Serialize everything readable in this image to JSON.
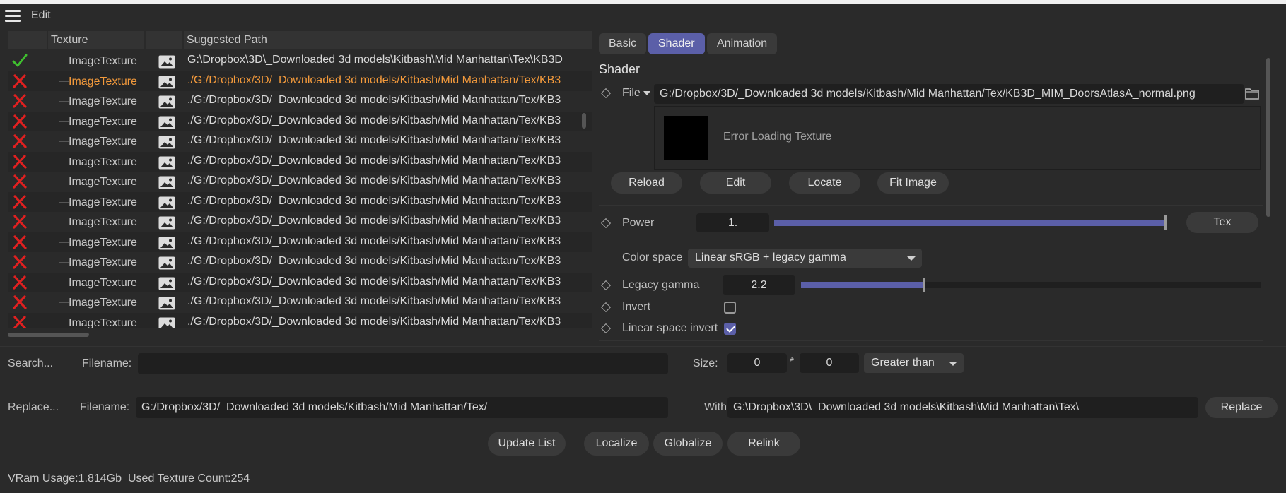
{
  "menu": {
    "edit_label": "Edit"
  },
  "table": {
    "headers": {
      "texture": "Texture",
      "suggested_path": "Suggested Path"
    },
    "rows": [
      {
        "status": "ok",
        "name": "ImageTexture",
        "path": "G:\\Dropbox\\3D\\_Downloaded 3d models\\Kitbash\\Mid Manhattan\\Tex\\KB3D",
        "selected": false
      },
      {
        "status": "error",
        "name": "ImageTexture",
        "path": "./G:/Dropbox/3D/_Downloaded 3d models/Kitbash/Mid Manhattan/Tex/KB3",
        "selected": true
      },
      {
        "status": "error",
        "name": "ImageTexture",
        "path": "./G:/Dropbox/3D/_Downloaded 3d models/Kitbash/Mid Manhattan/Tex/KB3",
        "selected": false
      },
      {
        "status": "error",
        "name": "ImageTexture",
        "path": "./G:/Dropbox/3D/_Downloaded 3d models/Kitbash/Mid Manhattan/Tex/KB3",
        "selected": false
      },
      {
        "status": "error",
        "name": "ImageTexture",
        "path": "./G:/Dropbox/3D/_Downloaded 3d models/Kitbash/Mid Manhattan/Tex/KB3",
        "selected": false
      },
      {
        "status": "error",
        "name": "ImageTexture",
        "path": "./G:/Dropbox/3D/_Downloaded 3d models/Kitbash/Mid Manhattan/Tex/KB3",
        "selected": false
      },
      {
        "status": "error",
        "name": "ImageTexture",
        "path": "./G:/Dropbox/3D/_Downloaded 3d models/Kitbash/Mid Manhattan/Tex/KB3",
        "selected": false
      },
      {
        "status": "error",
        "name": "ImageTexture",
        "path": "./G:/Dropbox/3D/_Downloaded 3d models/Kitbash/Mid Manhattan/Tex/KB3",
        "selected": false
      },
      {
        "status": "error",
        "name": "ImageTexture",
        "path": "./G:/Dropbox/3D/_Downloaded 3d models/Kitbash/Mid Manhattan/Tex/KB3",
        "selected": false
      },
      {
        "status": "error",
        "name": "ImageTexture",
        "path": "./G:/Dropbox/3D/_Downloaded 3d models/Kitbash/Mid Manhattan/Tex/KB3",
        "selected": false
      },
      {
        "status": "error",
        "name": "ImageTexture",
        "path": "./G:/Dropbox/3D/_Downloaded 3d models/Kitbash/Mid Manhattan/Tex/KB3",
        "selected": false
      },
      {
        "status": "error",
        "name": "ImageTexture",
        "path": "./G:/Dropbox/3D/_Downloaded 3d models/Kitbash/Mid Manhattan/Tex/KB3",
        "selected": false
      },
      {
        "status": "error",
        "name": "ImageTexture",
        "path": "./G:/Dropbox/3D/_Downloaded 3d models/Kitbash/Mid Manhattan/Tex/KB3",
        "selected": false
      },
      {
        "status": "error",
        "name": "ImageTexture",
        "path": "./G:/Dropbox/3D/_Downloaded 3d models/Kitbash/Mid Manhattan/Tex/KB3",
        "selected": false
      }
    ]
  },
  "tabs": {
    "basic": "Basic",
    "shader": "Shader",
    "animation": "Animation",
    "active": "Shader"
  },
  "shader": {
    "title": "Shader",
    "file_label": "File",
    "file_value": "G:/Dropbox/3D/_Downloaded 3d models/Kitbash/Mid Manhattan/Tex/KB3D_MIM_DoorsAtlasA_normal.png",
    "preview_error": "Error Loading Texture",
    "buttons": {
      "reload": "Reload",
      "edit": "Edit",
      "locate": "Locate",
      "fit_image": "Fit Image"
    },
    "power_label": "Power",
    "power_value": "1.",
    "power_fill": 1.0,
    "tex_button": "Tex",
    "color_space_label": "Color space",
    "color_space_value": "Linear sRGB + legacy gamma",
    "legacy_gamma_label": "Legacy gamma",
    "legacy_gamma_value": "2.2",
    "legacy_gamma_fill": 0.27,
    "invert_label": "Invert",
    "invert_checked": false,
    "linear_space_invert_label": "Linear space invert",
    "linear_space_invert_checked": true
  },
  "search": {
    "label": "Search...",
    "filename_label": "Filename:",
    "filename_value": "",
    "size_label": "Size:",
    "size_w": "0",
    "size_sep": "*",
    "size_h": "0",
    "compare_value": "Greater than"
  },
  "replace": {
    "label": "Replace...",
    "filename_label": "Filename:",
    "filename_value": "G:/Dropbox/3D/_Downloaded 3d models/Kitbash/Mid Manhattan/Tex/",
    "with_label": "With:",
    "with_value": "G:\\Dropbox\\3D\\_Downloaded 3d models\\Kitbash\\Mid Manhattan\\Tex\\",
    "replace_button": "Replace"
  },
  "actions": {
    "update_list": "Update List",
    "localize": "Localize",
    "globalize": "Globalize",
    "relink": "Relink"
  },
  "status": {
    "vram": "VRam Usage:1.814Gb",
    "texture_count": "Used Texture Count:254"
  },
  "colors": {
    "accent": "#5b5fa8",
    "selected_text": "#f39a3c",
    "ok": "#3fbf2f",
    "error": "#e02020"
  }
}
